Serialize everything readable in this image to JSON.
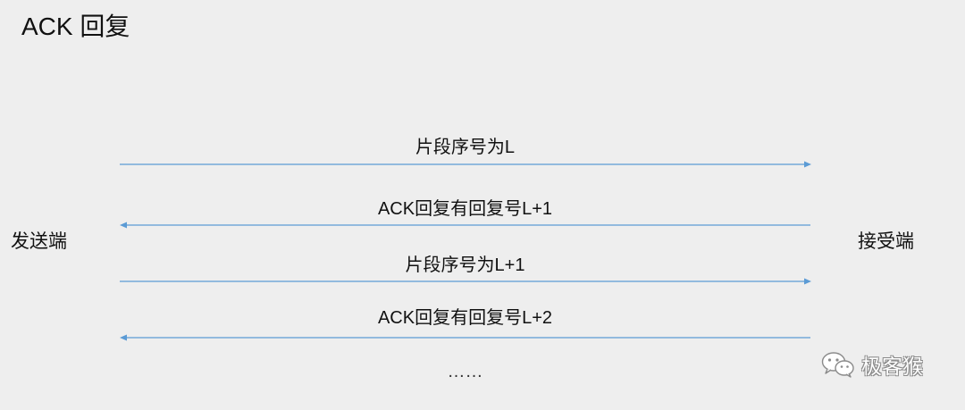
{
  "title": "ACK 回复",
  "sender_label": "发送端",
  "receiver_label": "接受端",
  "line_color": "#5b9bd5",
  "messages": [
    {
      "text": "片段序号为L",
      "direction": "to-receiver"
    },
    {
      "text": "ACK回复有回复号L+1",
      "direction": "to-sender"
    },
    {
      "text": "片段序号为L+1",
      "direction": "to-receiver"
    },
    {
      "text": "ACK回复有回复号L+2",
      "direction": "to-sender"
    }
  ],
  "continuation": "……",
  "watermark": {
    "icon": "wechat-icon",
    "text": "极客猴"
  }
}
